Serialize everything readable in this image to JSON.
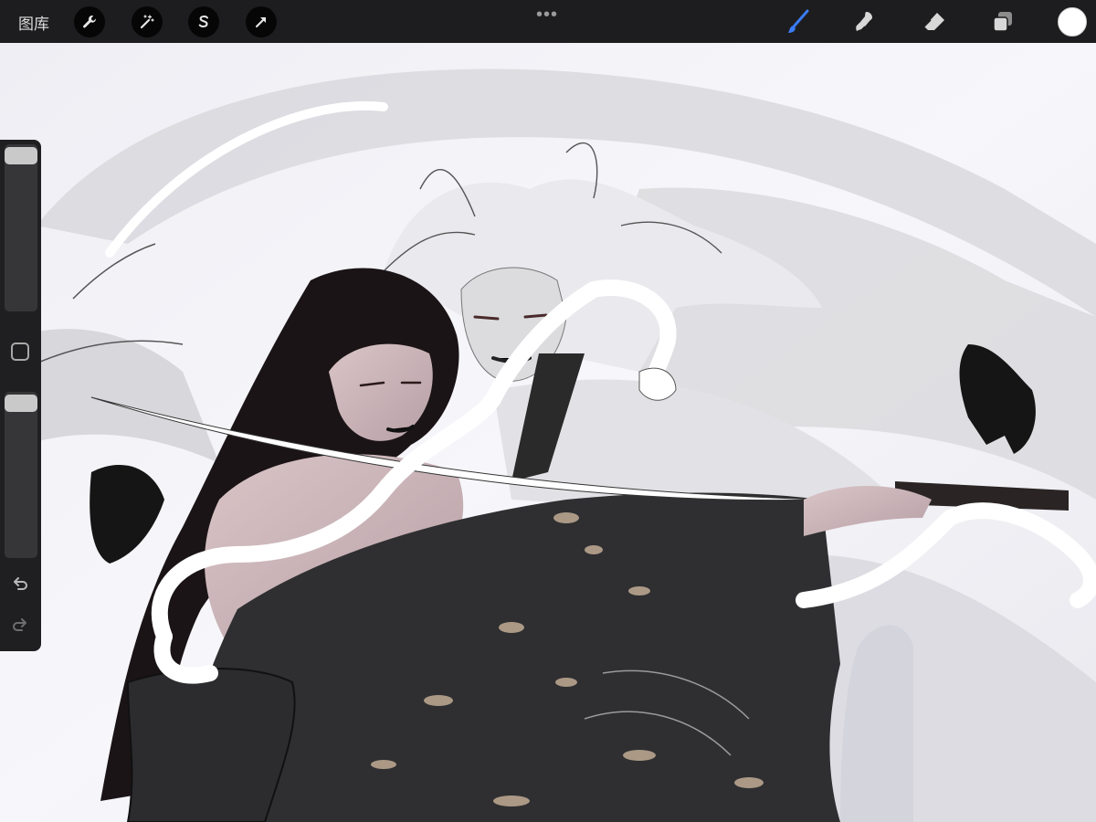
{
  "topbar": {
    "gallery_label": "图库",
    "left_tools": [
      {
        "icon": "wrench-icon",
        "name": "actions"
      },
      {
        "icon": "magic-wand-icon",
        "name": "adjustments"
      },
      {
        "icon": "selection-s-icon",
        "name": "selection"
      },
      {
        "icon": "arrow-cursor-icon",
        "name": "transform"
      }
    ],
    "more_label": "•••",
    "right_tools": [
      {
        "icon": "brush-icon",
        "name": "brush",
        "active": true
      },
      {
        "icon": "smudge-icon",
        "name": "smudge"
      },
      {
        "icon": "eraser-icon",
        "name": "eraser"
      },
      {
        "icon": "layers-icon",
        "name": "layers"
      }
    ],
    "current_color": "#ffffff"
  },
  "sidebar": {
    "brush_size_fraction": 0.98,
    "opacity_fraction": 0.98,
    "undo_icon": "undo-arrow-icon",
    "redo_icon": "redo-arrow-icon"
  },
  "colors": {
    "toolbar_bg": "#1d1d1f",
    "active_tool": "#3a7cf5",
    "canvas_bg": "#f3f3f6"
  }
}
